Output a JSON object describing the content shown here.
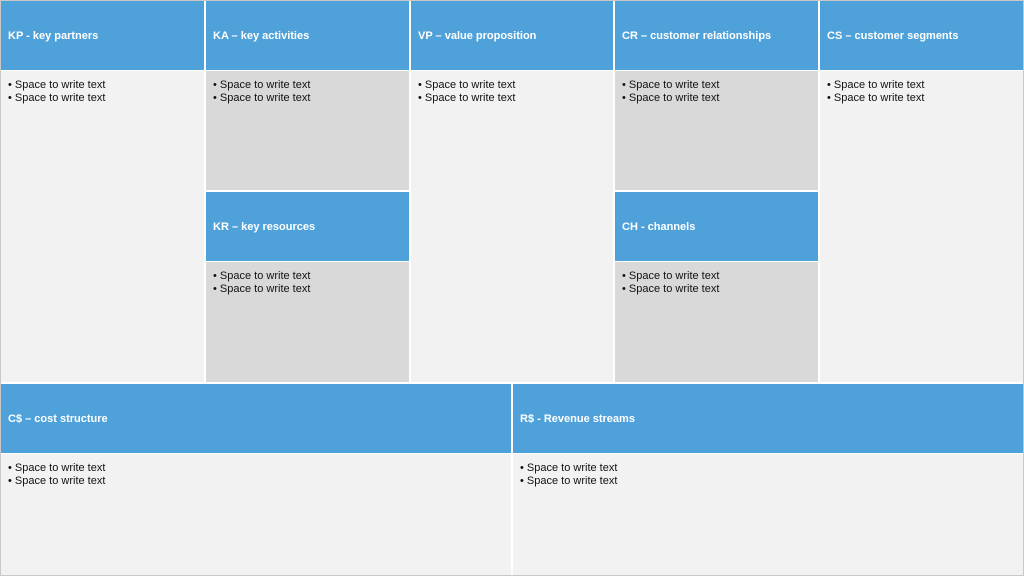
{
  "blocks": {
    "kp": {
      "title": "KP - key partners",
      "items": [
        "Space to write text",
        "Space to write text"
      ]
    },
    "ka": {
      "title": "KA – key activities",
      "items": [
        "Space to write text",
        "Space to write text"
      ]
    },
    "kr": {
      "title": "KR – key resources",
      "items": [
        "Space to write text",
        "Space to write text"
      ]
    },
    "vp": {
      "title": "VP – value proposition",
      "items": [
        "Space to write text",
        "Space to write text"
      ]
    },
    "cr": {
      "title": "CR – customer relationships",
      "items": [
        "Space to write text",
        "Space to write text"
      ]
    },
    "ch": {
      "title": "CH - channels",
      "items": [
        "Space to write text",
        "Space to write text"
      ]
    },
    "cs": {
      "title": "CS – customer segments",
      "items": [
        "Space to write text",
        "Space to write text"
      ]
    },
    "cost": {
      "title": "C$ – cost structure",
      "items": [
        "Space to write text",
        "Space to write text"
      ]
    },
    "rev": {
      "title": "R$ - Revenue streams",
      "items": [
        "Space to write text",
        "Space to write text"
      ]
    }
  },
  "colors": {
    "header": "#4fa1da",
    "body_light": "#f2f2f2",
    "body_dark": "#d9d9d9"
  }
}
